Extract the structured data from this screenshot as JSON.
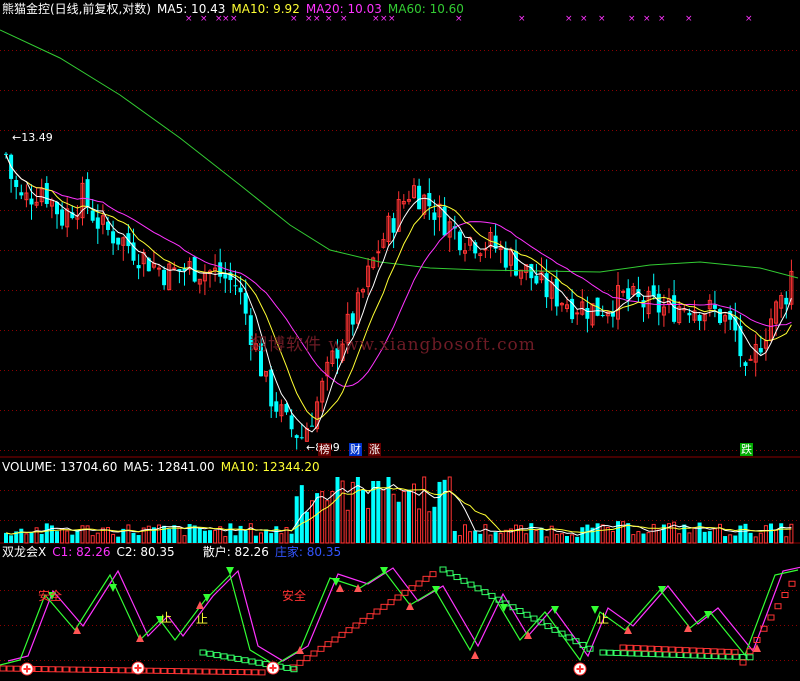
{
  "colors": {
    "bg": "#000000",
    "grid": "#8b0000",
    "up": "#ff3333",
    "down": "#00ffff",
    "ma5": "#ffffff",
    "ma10": "#ffff33",
    "ma20": "#ff33ff",
    "ma60": "#33cc33",
    "text": "#ffffff",
    "k_line": "#33ff33",
    "d_line": "#ff33ff",
    "scatter": "#33ff66",
    "banker": "#ff3333"
  },
  "header": {
    "title": "熊猫金控(日线,前复权,对数)",
    "ma5": "MA5: 10.43",
    "ma10": "MA10: 9.92",
    "ma20": "MA20: 10.03",
    "ma60": "MA60: 10.60"
  },
  "volume_header": {
    "volume": "VOLUME: 13704.60",
    "ma5": "MA5: 12841.00",
    "ma10": "MA10: 12344.20"
  },
  "indicator_header": {
    "name": "双龙会X",
    "c1": "C1: 82.26",
    "c2": "C2: 80.35",
    "sanhu": "散户: 82.26",
    "zhuangjia": "庄家: 80.35"
  },
  "price_annotations": {
    "high": "13.49",
    "low": "8.09"
  },
  "price_markers": [
    {
      "text": "榜",
      "x": 318
    },
    {
      "text": "财",
      "x": 349
    },
    {
      "text": "涨",
      "x": 368
    },
    {
      "text": "跌",
      "x": 740
    }
  ],
  "indicator_labels": [
    {
      "text": "安全",
      "x": 38,
      "y": 590
    },
    {
      "text": "止",
      "x": 160,
      "y": 612
    },
    {
      "text": "止",
      "x": 196,
      "y": 613
    },
    {
      "text": "安全",
      "x": 282,
      "y": 590
    },
    {
      "text": "止",
      "x": 597,
      "y": 613
    }
  ],
  "watermark": "翔博软件 www.xiangbosoft.com",
  "chart_data": {
    "type": "candlestick",
    "title": "熊猫金控(日线,前复权,对数)",
    "series": [
      {
        "name": "MA5",
        "value": 10.43
      },
      {
        "name": "MA10",
        "value": 9.92
      },
      {
        "name": "MA20",
        "value": 10.03
      },
      {
        "name": "MA60",
        "value": 10.6
      }
    ],
    "y_annotations": {
      "high": 13.49,
      "low": 8.09
    },
    "volume": {
      "volume": 13704.6,
      "ma5": 12841.0,
      "ma10": 12344.2
    },
    "indicator": {
      "name": "双龙会X",
      "C1": 82.26,
      "C2": 80.35,
      "散户": 82.26,
      "庄家": 80.35
    }
  }
}
